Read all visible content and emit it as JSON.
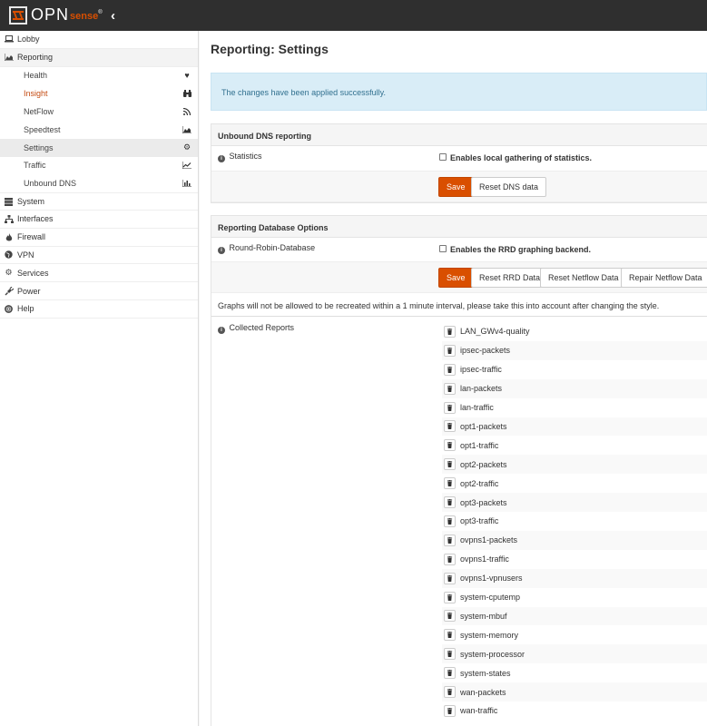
{
  "brand": {
    "logo_text": "OPN",
    "logo_text_accent": "sense",
    "registered": "®"
  },
  "sidebar": {
    "items": [
      {
        "label": "Lobby",
        "icon": "laptop-icon"
      },
      {
        "label": "Reporting",
        "icon": "area-chart-icon"
      },
      {
        "label": "Health",
        "icon": "heartbeat-icon"
      },
      {
        "label": "Insight",
        "icon": "binoculars-icon"
      },
      {
        "label": "NetFlow",
        "icon": "rss-icon"
      },
      {
        "label": "Speedtest",
        "icon": "area-chart-icon"
      },
      {
        "label": "Settings",
        "icon": "gear-icon"
      },
      {
        "label": "Traffic",
        "icon": "line-chart-icon"
      },
      {
        "label": "Unbound DNS",
        "icon": "bar-chart-icon"
      },
      {
        "label": "System",
        "icon": "server-icon"
      },
      {
        "label": "Interfaces",
        "icon": "sitemap-icon"
      },
      {
        "label": "Firewall",
        "icon": "fire-icon"
      },
      {
        "label": "VPN",
        "icon": "globe-icon"
      },
      {
        "label": "Services",
        "icon": "cog-icon"
      },
      {
        "label": "Power",
        "icon": "plug-icon"
      },
      {
        "label": "Help",
        "icon": "life-ring-icon"
      }
    ]
  },
  "page": {
    "title": "Reporting: Settings",
    "alert": "The changes have been applied successfully."
  },
  "dns_panel": {
    "header": "Unbound DNS reporting",
    "statistics_label": "Statistics",
    "statistics_checkbox": "Enables local gathering of statistics.",
    "save": "Save",
    "reset": "Reset DNS data"
  },
  "db_panel": {
    "header": "Reporting Database Options",
    "rrd_label": "Round-Robin-Database",
    "rrd_checkbox": "Enables the RRD graphing backend.",
    "save": "Save",
    "reset_rrd": "Reset RRD Data",
    "reset_netflow": "Reset Netflow Data",
    "repair_netflow": "Repair Netflow Data",
    "note": "Graphs will not be allowed to be recreated within a 1 minute interval, please take this into account after changing the style.",
    "collected_label": "Collected Reports",
    "reports": [
      "LAN_GWv4-quality",
      "ipsec-packets",
      "ipsec-traffic",
      "lan-packets",
      "lan-traffic",
      "opt1-packets",
      "opt1-traffic",
      "opt2-packets",
      "opt2-traffic",
      "opt3-packets",
      "opt3-traffic",
      "ovpns1-packets",
      "ovpns1-traffic",
      "ovpns1-vpnusers",
      "system-cputemp",
      "system-mbuf",
      "system-memory",
      "system-processor",
      "system-states",
      "wan-packets",
      "wan-traffic"
    ]
  }
}
